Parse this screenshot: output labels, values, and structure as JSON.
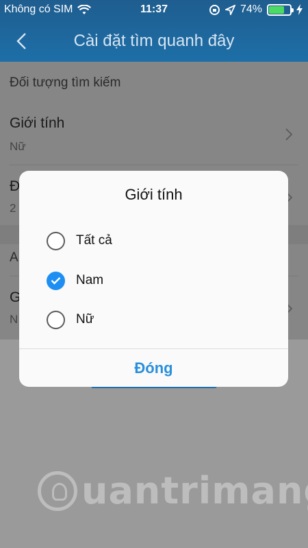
{
  "status_bar": {
    "carrier": "Không có SIM",
    "time": "11:37",
    "battery_percent": "74%",
    "battery_level": 0.74
  },
  "nav": {
    "title": "Cài đặt tìm quanh đây"
  },
  "background": {
    "section_label": "Đối tượng tìm kiếm",
    "gender_row": {
      "title": "Giới tính",
      "value": "Nữ"
    },
    "partial_row_1": {
      "title": "Đ",
      "value": "2"
    },
    "partial_section": "A",
    "partial_row_2": {
      "title": "G",
      "value": "N"
    }
  },
  "dialog": {
    "title": "Giới tính",
    "options": [
      {
        "label": "Tất cả",
        "checked": false
      },
      {
        "label": "Nam",
        "checked": true
      },
      {
        "label": "Nữ",
        "checked": false
      }
    ],
    "close_label": "Đóng"
  },
  "watermark": {
    "text": "uantrimang"
  },
  "colors": {
    "header": "#1d6fa8",
    "accent": "#1e8ff2",
    "button_text": "#2a8fdc",
    "battery": "#4cd964"
  }
}
